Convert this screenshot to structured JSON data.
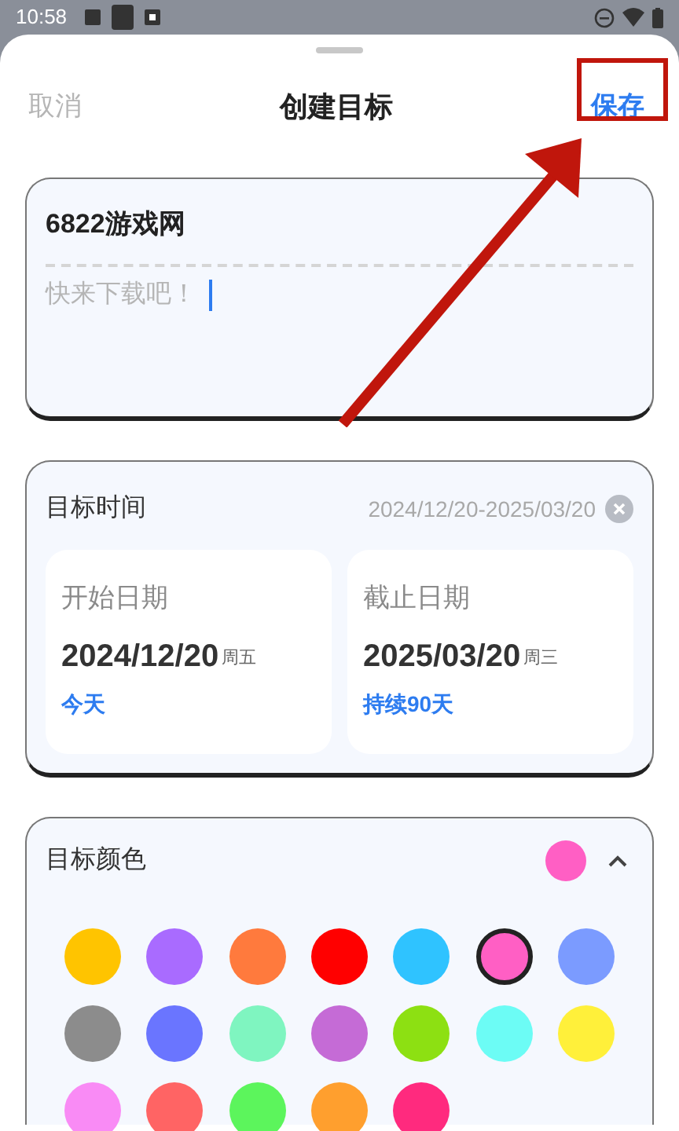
{
  "status_bar": {
    "time": "10:58"
  },
  "header": {
    "cancel": "取消",
    "title": "创建目标",
    "save": "保存"
  },
  "note": {
    "title": "6822游戏网",
    "description": "快来下载吧！",
    "focused": true
  },
  "target_time": {
    "label": "目标时间",
    "range": "2024/12/20-2025/03/20",
    "start": {
      "label": "开始日期",
      "date": "2024/12/20",
      "weekday": "周五",
      "note": "今天"
    },
    "end": {
      "label": "截止日期",
      "date": "2025/03/20",
      "weekday": "周三",
      "note": "持续90天"
    }
  },
  "target_color": {
    "label": "目标颜色",
    "color": "#ff5fc4",
    "expanded": true,
    "swatches": [
      {
        "color": "#ffc400",
        "selected": false
      },
      {
        "color": "#a96bff",
        "selected": false
      },
      {
        "color": "#ff7a3d",
        "selected": false
      },
      {
        "color": "#ff0000",
        "selected": false
      },
      {
        "color": "#2fc3ff",
        "selected": false
      },
      {
        "color": "#ff5fc4",
        "selected": true
      },
      {
        "color": "#7b9bff",
        "selected": false
      },
      {
        "color": "#8c8c8c",
        "selected": false
      },
      {
        "color": "#6a75ff",
        "selected": false
      },
      {
        "color": "#7ff5c0",
        "selected": false
      },
      {
        "color": "#c56bd6",
        "selected": false
      },
      {
        "color": "#8de012",
        "selected": false
      },
      {
        "color": "#6cfcf5",
        "selected": false
      },
      {
        "color": "#fff03a",
        "selected": false
      },
      {
        "color": "#f98bf5",
        "selected": false
      },
      {
        "color": "#ff6464",
        "selected": false
      },
      {
        "color": "#5cf55c",
        "selected": false
      },
      {
        "color": "#ff9f2e",
        "selected": false
      },
      {
        "color": "#ff2a7e",
        "selected": false
      }
    ]
  },
  "annotation": {
    "highlight": true
  }
}
